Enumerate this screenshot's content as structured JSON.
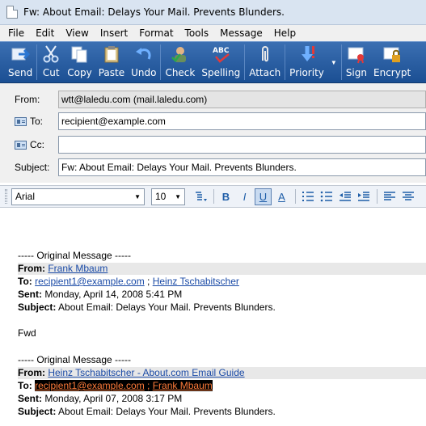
{
  "window": {
    "title": "Fw: About Email: Delays Your Mail. Prevents Blunders."
  },
  "menu": [
    "File",
    "Edit",
    "View",
    "Insert",
    "Format",
    "Tools",
    "Message",
    "Help"
  ],
  "toolbar": {
    "send": "Send",
    "cut": "Cut",
    "copy": "Copy",
    "paste": "Paste",
    "undo": "Undo",
    "check": "Check",
    "spelling": "Spelling",
    "attach": "Attach",
    "priority": "Priority",
    "sign": "Sign",
    "encrypt": "Encrypt",
    "spelling_icon_text": "ABC"
  },
  "header": {
    "from_label": "From:",
    "from_value": "wtt@laledu.com     (mail.laledu.com)",
    "to_label": "To:",
    "to_value": "recipient@example.com",
    "cc_label": "Cc:",
    "cc_value": "",
    "subject_label": "Subject:",
    "subject_value": "Fw: About Email: Delays Your Mail. Prevents Blunders."
  },
  "format": {
    "font": "Arial",
    "size": "10",
    "bold": "B",
    "italic": "I",
    "underline": "U",
    "fontcolor": "A"
  },
  "body": {
    "orig1": "----- Original Message -----",
    "from1_label": "From:",
    "from1_name": "Frank Mbaum",
    "to1_label": "To:",
    "to1_a": "recipient1@example.com",
    "sep": ";",
    "to1_b": "Heinz Tschabitscher",
    "sent1_label": "Sent:",
    "sent1_value": "Monday, April 14, 2008 5:41 PM",
    "subj1_label": "Subject:",
    "subj1_value": "About Email: Delays Your Mail. Prevents Blunders.",
    "fwd": "Fwd",
    "orig2": "----- Original Message -----",
    "from2_label": "From:",
    "from2_name": "Heinz Tschabitscher - About.com Email Guide",
    "to2_label": "To:",
    "to2_a": "recipient1@example.com",
    "to2_b": "Frank Mbaum",
    "sent2_label": "Sent:",
    "sent2_value": "Monday, April 07, 2008 3:17 PM",
    "subj2_label": "Subject:",
    "subj2_value": "About Email: Delays Your Mail. Prevents Blunders."
  }
}
